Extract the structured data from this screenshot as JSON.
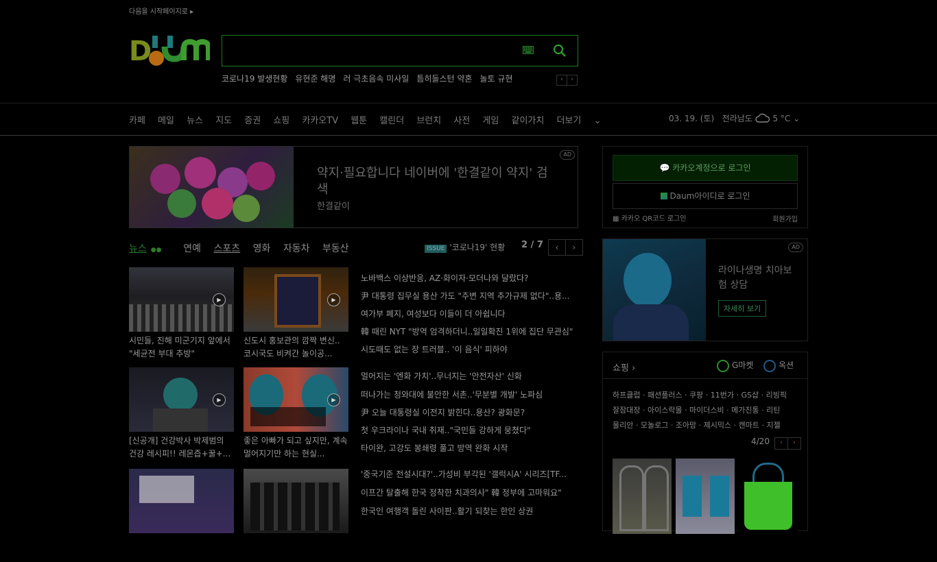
{
  "header": {
    "start_page": "다음을 시작페이지로 ▸",
    "logo_text": "Daum",
    "search_placeholder": "",
    "trending": [
      "코로나19 발생현황",
      "유현준 해명",
      "러 극초음속 미사일",
      "틈히들스턴 약혼",
      "놀토 규현"
    ]
  },
  "nav": {
    "items": [
      "카페",
      "메일",
      "뉴스",
      "지도",
      "증권",
      "쇼핑",
      "카카오TV",
      "웹툰",
      "캘린더",
      "브런치",
      "사전",
      "게임",
      "같이가치",
      "더보기"
    ],
    "date": "03. 19. (토)",
    "region": "전라남도",
    "temp": "5 °C"
  },
  "ad_banner": {
    "title": "약지·필요합니다 네이버에 '한결같이 약지' 검색",
    "subtitle": "한결같이",
    "badge": "AD"
  },
  "news": {
    "tabs": [
      "뉴스",
      "연예",
      "스포츠",
      "영화",
      "자동차",
      "부동산"
    ],
    "issue_badge": "ISSUE",
    "issue_text": "'코로나19' 현황",
    "page": "2 / 7",
    "thumbs": [
      {
        "caption": "시민들, 진해 미군기지 앞에서 \"세균전 부대 추방\""
      },
      {
        "caption": "신도시 홍보관의 깜짝 변신.. 코시국도 비켜간 놀이공..."
      },
      {
        "caption": "[신공개] 건강박사 박제범의 건강 레시피!! 레몬즙+꿀+..."
      },
      {
        "caption": "좋은 아빠가 되고 싶지만, 계속 멀어지기만 하는 현실..."
      },
      {
        "caption": ""
      },
      {
        "caption": ""
      }
    ],
    "headlines": [
      "노바백스 이상반응, AZ·화이자·모더나와 달랐다?",
      "尹 대통령 집무실 용산 가도 \"주변 지역 추가규제 없다\"..용...",
      "여가부 폐지, 여성보다 이들이 더 아쉽니다",
      "韓 때린 NYT \"방역 엄격하더니..일일확진 1위에 집단 무관심\"",
      "시도때도 없는 장 트러블.. '이 음식' 피하야",
      "멀어지는 '엔화 가치'..무너지는 '안전자산' 신화",
      "떠나가는 청와대에 불안한 서촌..'무분별 개발' 노파심",
      "尹 오늘 대통령실 이전지 밝힌다..용산? 광화문?",
      "첫 우크라이나 국내 취재..\"국민들 강하게 뭉쳤다\"",
      "타이완, 고강도 봉쇄령 풀고 방역 완화 시작",
      "'중국기준 전설시대?'..가성비 부각된 '갤럭시A' 시리즈[TF...",
      "이프간 탈출해 한국 정착한 치과의사\" 韓 정부에 고마워요\"",
      "한국인 여행객 돌린 사이판..활기 되찾는 한인 상권"
    ]
  },
  "login": {
    "kakao_button": "카카오계정으로 로그인",
    "daum_button": "Daum아이디로 로그인",
    "qr_text": "카카오 QR코드 로그인",
    "signup": "회원가입"
  },
  "ad_right": {
    "title": "라이나생명 치아보험 상담",
    "button": "자세히 보기",
    "badge": "AD"
  },
  "shopping": {
    "title": "쇼핑 ›",
    "gmarket": "G마켓",
    "auction": "옥션",
    "lines": [
      "하프클럽 · 패션플러스 · 쿠팡 · 11번가 · GS샵 · 리빙픽",
      "잘잠대장 · 아이스락몰 · 마이더스비 · 메가진통 · 리틴",
      "몰리안 · 모놀로그 · 조아맘 · 제시믹스 · 캔마트 · 지젤"
    ],
    "page": "4/20"
  }
}
